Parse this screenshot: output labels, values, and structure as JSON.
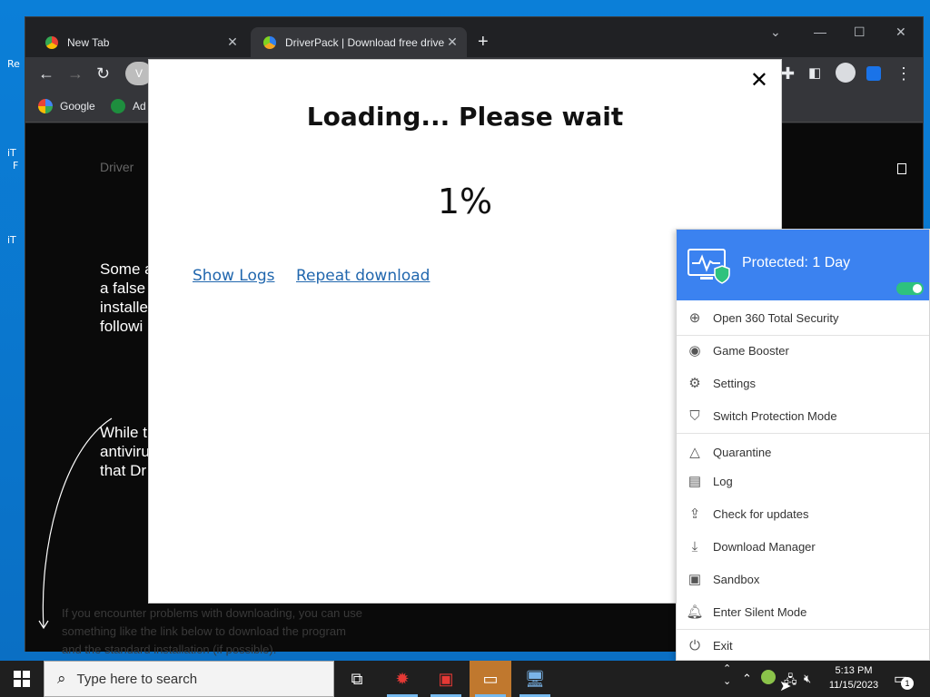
{
  "desktop": {
    "label_re": "Re",
    "label_it1": "iT",
    "label_f": "F",
    "label_it2": "iT"
  },
  "browser": {
    "tabs": [
      {
        "label": "New Tab"
      },
      {
        "label": "DriverPack | Download free drive"
      }
    ],
    "bookmarks": [
      {
        "label": "Google"
      },
      {
        "label": "Ad"
      }
    ],
    "omnibox_badge": "V",
    "page": {
      "brand": "Driver",
      "para1": [
        "Some a",
        "a false",
        "installe",
        "followi"
      ],
      "para2": [
        "While t",
        "antiviru",
        "that Dr"
      ],
      "footer_lines": [
        "If you encounter problems with downloading, you can use",
        "something like the link below to download the program",
        "and the standard installation (if possible)."
      ]
    }
  },
  "modal": {
    "title": "Loading... Please wait",
    "percent": "1%",
    "progress": 0.01,
    "show_logs": "Show Logs",
    "repeat_download": "Repeat download"
  },
  "menu360": {
    "status": "Protected: 1 Day",
    "items": [
      {
        "label": "Open 360 Total Security",
        "icon": "plus-circle-icon"
      },
      {
        "label": "Game Booster",
        "icon": "gamepad-icon"
      },
      {
        "label": "Settings",
        "icon": "gear-icon"
      },
      {
        "label": "Switch Protection Mode",
        "icon": "shield-bolt-icon"
      },
      {
        "label": "Quarantine",
        "icon": "flask-icon"
      },
      {
        "label": "Log",
        "icon": "document-icon"
      },
      {
        "label": "Check for updates",
        "icon": "upload-icon"
      },
      {
        "label": "Download Manager",
        "icon": "download-icon"
      },
      {
        "label": "Sandbox",
        "icon": "box-icon"
      },
      {
        "label": "Enter Silent Mode",
        "icon": "bell-icon"
      },
      {
        "label": "Exit",
        "icon": "power-icon"
      }
    ]
  },
  "taskbar": {
    "search_placeholder": "Type here to search",
    "time": "5:13 PM",
    "date": "11/15/2023",
    "notification_count": "1"
  },
  "colors": {
    "accent_360": "#3b82f0",
    "toggle_on": "#2ec27e",
    "link": "#2167ae"
  }
}
